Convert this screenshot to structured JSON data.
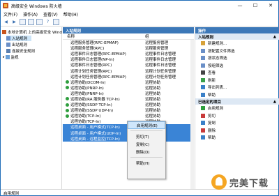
{
  "window": {
    "title": "高级安全 Windows 防火墙"
  },
  "menu": [
    "文件(F)",
    "操作(A)",
    "查看(V)",
    "帮助(H)"
  ],
  "nav": {
    "items": [
      {
        "label": "本地计算机 上的高级安全 Wind",
        "indent": 0
      },
      {
        "label": "入站规则",
        "indent": 1,
        "selected": true
      },
      {
        "label": "出站规则",
        "indent": 1
      },
      {
        "label": "连接安全规则",
        "indent": 1
      },
      {
        "label": "监视",
        "indent": 1
      }
    ]
  },
  "center": {
    "header": "入站规则",
    "columns": [
      "名称",
      "组"
    ],
    "rows": [
      {
        "name": "远程服务管理(RPC-EPMAP)",
        "group": "远程服务管理",
        "enabled": false
      },
      {
        "name": "远程服务管理(RPC)",
        "group": "远程服务管理",
        "enabled": false
      },
      {
        "name": "远程事件日志管理(RPC-EPMAP)",
        "group": "远程事件日志管理",
        "enabled": false
      },
      {
        "name": "远程事件日志管理(NP-In)",
        "group": "远程事件日志管理",
        "enabled": false
      },
      {
        "name": "远程事件日志管理(RPC)",
        "group": "远程事件日志管理",
        "enabled": false
      },
      {
        "name": "远程计划任务管理(RPC)",
        "group": "远程计划任务管理",
        "enabled": false
      },
      {
        "name": "远程计划任务管理(RPC-EPMAP)",
        "group": "远程计划任务管理",
        "enabled": false
      },
      {
        "name": "远程协助(DCOM-In)",
        "group": "远程协助",
        "enabled": true
      },
      {
        "name": "远程协助(PNRP-In)",
        "group": "远程协助",
        "enabled": true
      },
      {
        "name": "远程协助(PNRP-In)",
        "group": "远程协助",
        "enabled": false
      },
      {
        "name": "远程协助(RA 服务器 TCP-In)",
        "group": "远程协助",
        "enabled": true
      },
      {
        "name": "远程协助(SSDP TCP-In)",
        "group": "远程协助",
        "enabled": true
      },
      {
        "name": "远程协助(SSDP UDP-In)",
        "group": "远程协助",
        "enabled": true
      },
      {
        "name": "远程协助(TCP-In)",
        "group": "远程协助",
        "enabled": true
      },
      {
        "name": "远程协助(TCP-In)",
        "group": "远程协助",
        "enabled": false
      },
      {
        "name": "远程桌面 - 用户模式(TCP-In)",
        "group": "远程桌面",
        "enabled": false,
        "selected": true
      },
      {
        "name": "远程桌面 - 用户模式(UDP-In)",
        "group": "远程桌面",
        "enabled": false,
        "selected": true
      },
      {
        "name": "远程桌面 - 远程监控(TCP-In)",
        "group": "远程桌面",
        "enabled": false,
        "selected": true
      }
    ]
  },
  "context_menu": {
    "items": [
      "启用规则(E)",
      "剪切(T)",
      "复制(C)",
      "删除(D)",
      "帮助(H)"
    ]
  },
  "actions": {
    "header": "操作",
    "section1": "入站规则",
    "section1_items": [
      "新建规则...",
      "按配置文件筛选",
      "按状态筛选",
      "按组筛选",
      "查看",
      "刷新",
      "导出列表...",
      "帮助"
    ],
    "section2": "已选定的项目",
    "section2_items": [
      "启用规则",
      "剪切",
      "复制",
      "删除",
      "帮助"
    ]
  },
  "statusbar": {
    "text": "启用规则"
  },
  "watermark": {
    "text": "完美下载"
  }
}
